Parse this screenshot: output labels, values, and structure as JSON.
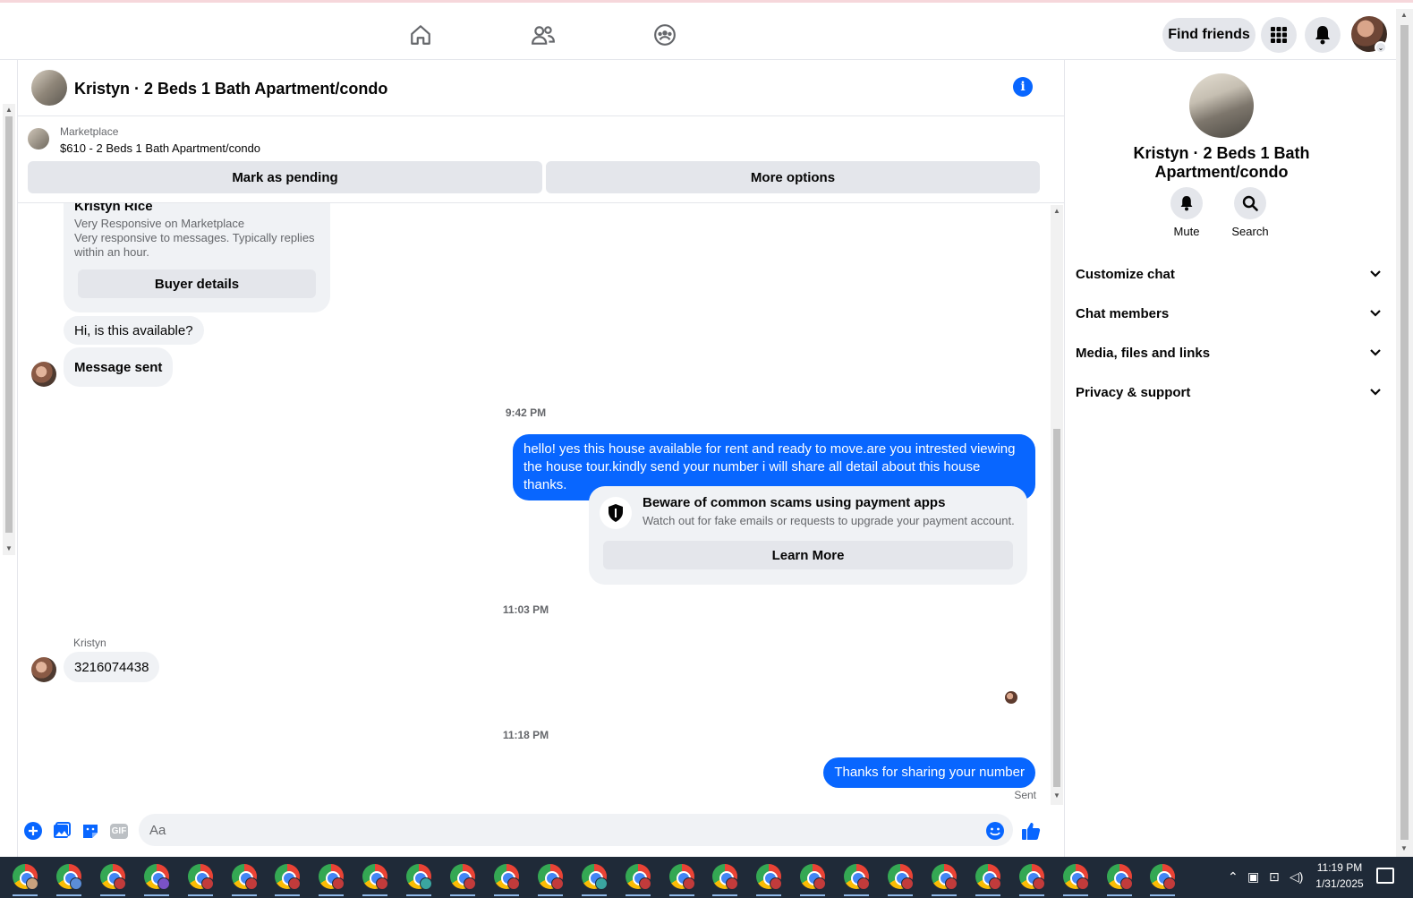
{
  "nav": {
    "find_friends": "Find friends",
    "icons": [
      "home-icon",
      "friends-icon",
      "groups-icon",
      "apps-grid-icon",
      "bell-icon"
    ]
  },
  "chat": {
    "title": "Kristyn · 2 Beds 1 Bath Apartment/condo",
    "marketplace_label": "Marketplace",
    "listing": "$610 - 2 Beds 1 Bath Apartment/condo",
    "mark_pending": "Mark as pending",
    "more_options": "More options"
  },
  "seller_card": {
    "name": "Kristyn Rice",
    "line1": "Very Responsive on Marketplace",
    "line2": "Very responsive to messages. Typically replies within an hour.",
    "buyer_details": "Buyer details"
  },
  "messages": {
    "in1": "Hi, is this available?",
    "in2": "Message sent",
    "time1": "9:42 PM",
    "out1": "hello! yes this house available for rent and ready to move.are you intrested viewing the house tour.kindly send your number i will share all detail about this house thanks.",
    "scam_title": "Beware of common scams using payment apps",
    "scam_text": "Watch out for fake emails or requests to upgrade your payment account.",
    "learn_more": "Learn More",
    "time2": "11:03 PM",
    "sender": "Kristyn",
    "in3": "3216074438",
    "time3": "11:18 PM",
    "out2": "Thanks for sharing your number",
    "status": "Sent"
  },
  "composer": {
    "placeholder": "Aa",
    "gif": "GIF"
  },
  "right_panel": {
    "title": "Kristyn · 2 Beds 1 Bath Apartment/condo",
    "mute": "Mute",
    "search": "Search",
    "sections": [
      "Customize chat",
      "Chat members",
      "Media, files and links",
      "Privacy & support"
    ]
  },
  "taskbar": {
    "time": "11:19 PM",
    "date": "1/31/2025"
  },
  "colors": {
    "accent": "#0866ff",
    "bubble_in": "#f0f2f5",
    "button_gray": "#e4e6eb",
    "taskbar": "#1f2a38"
  }
}
